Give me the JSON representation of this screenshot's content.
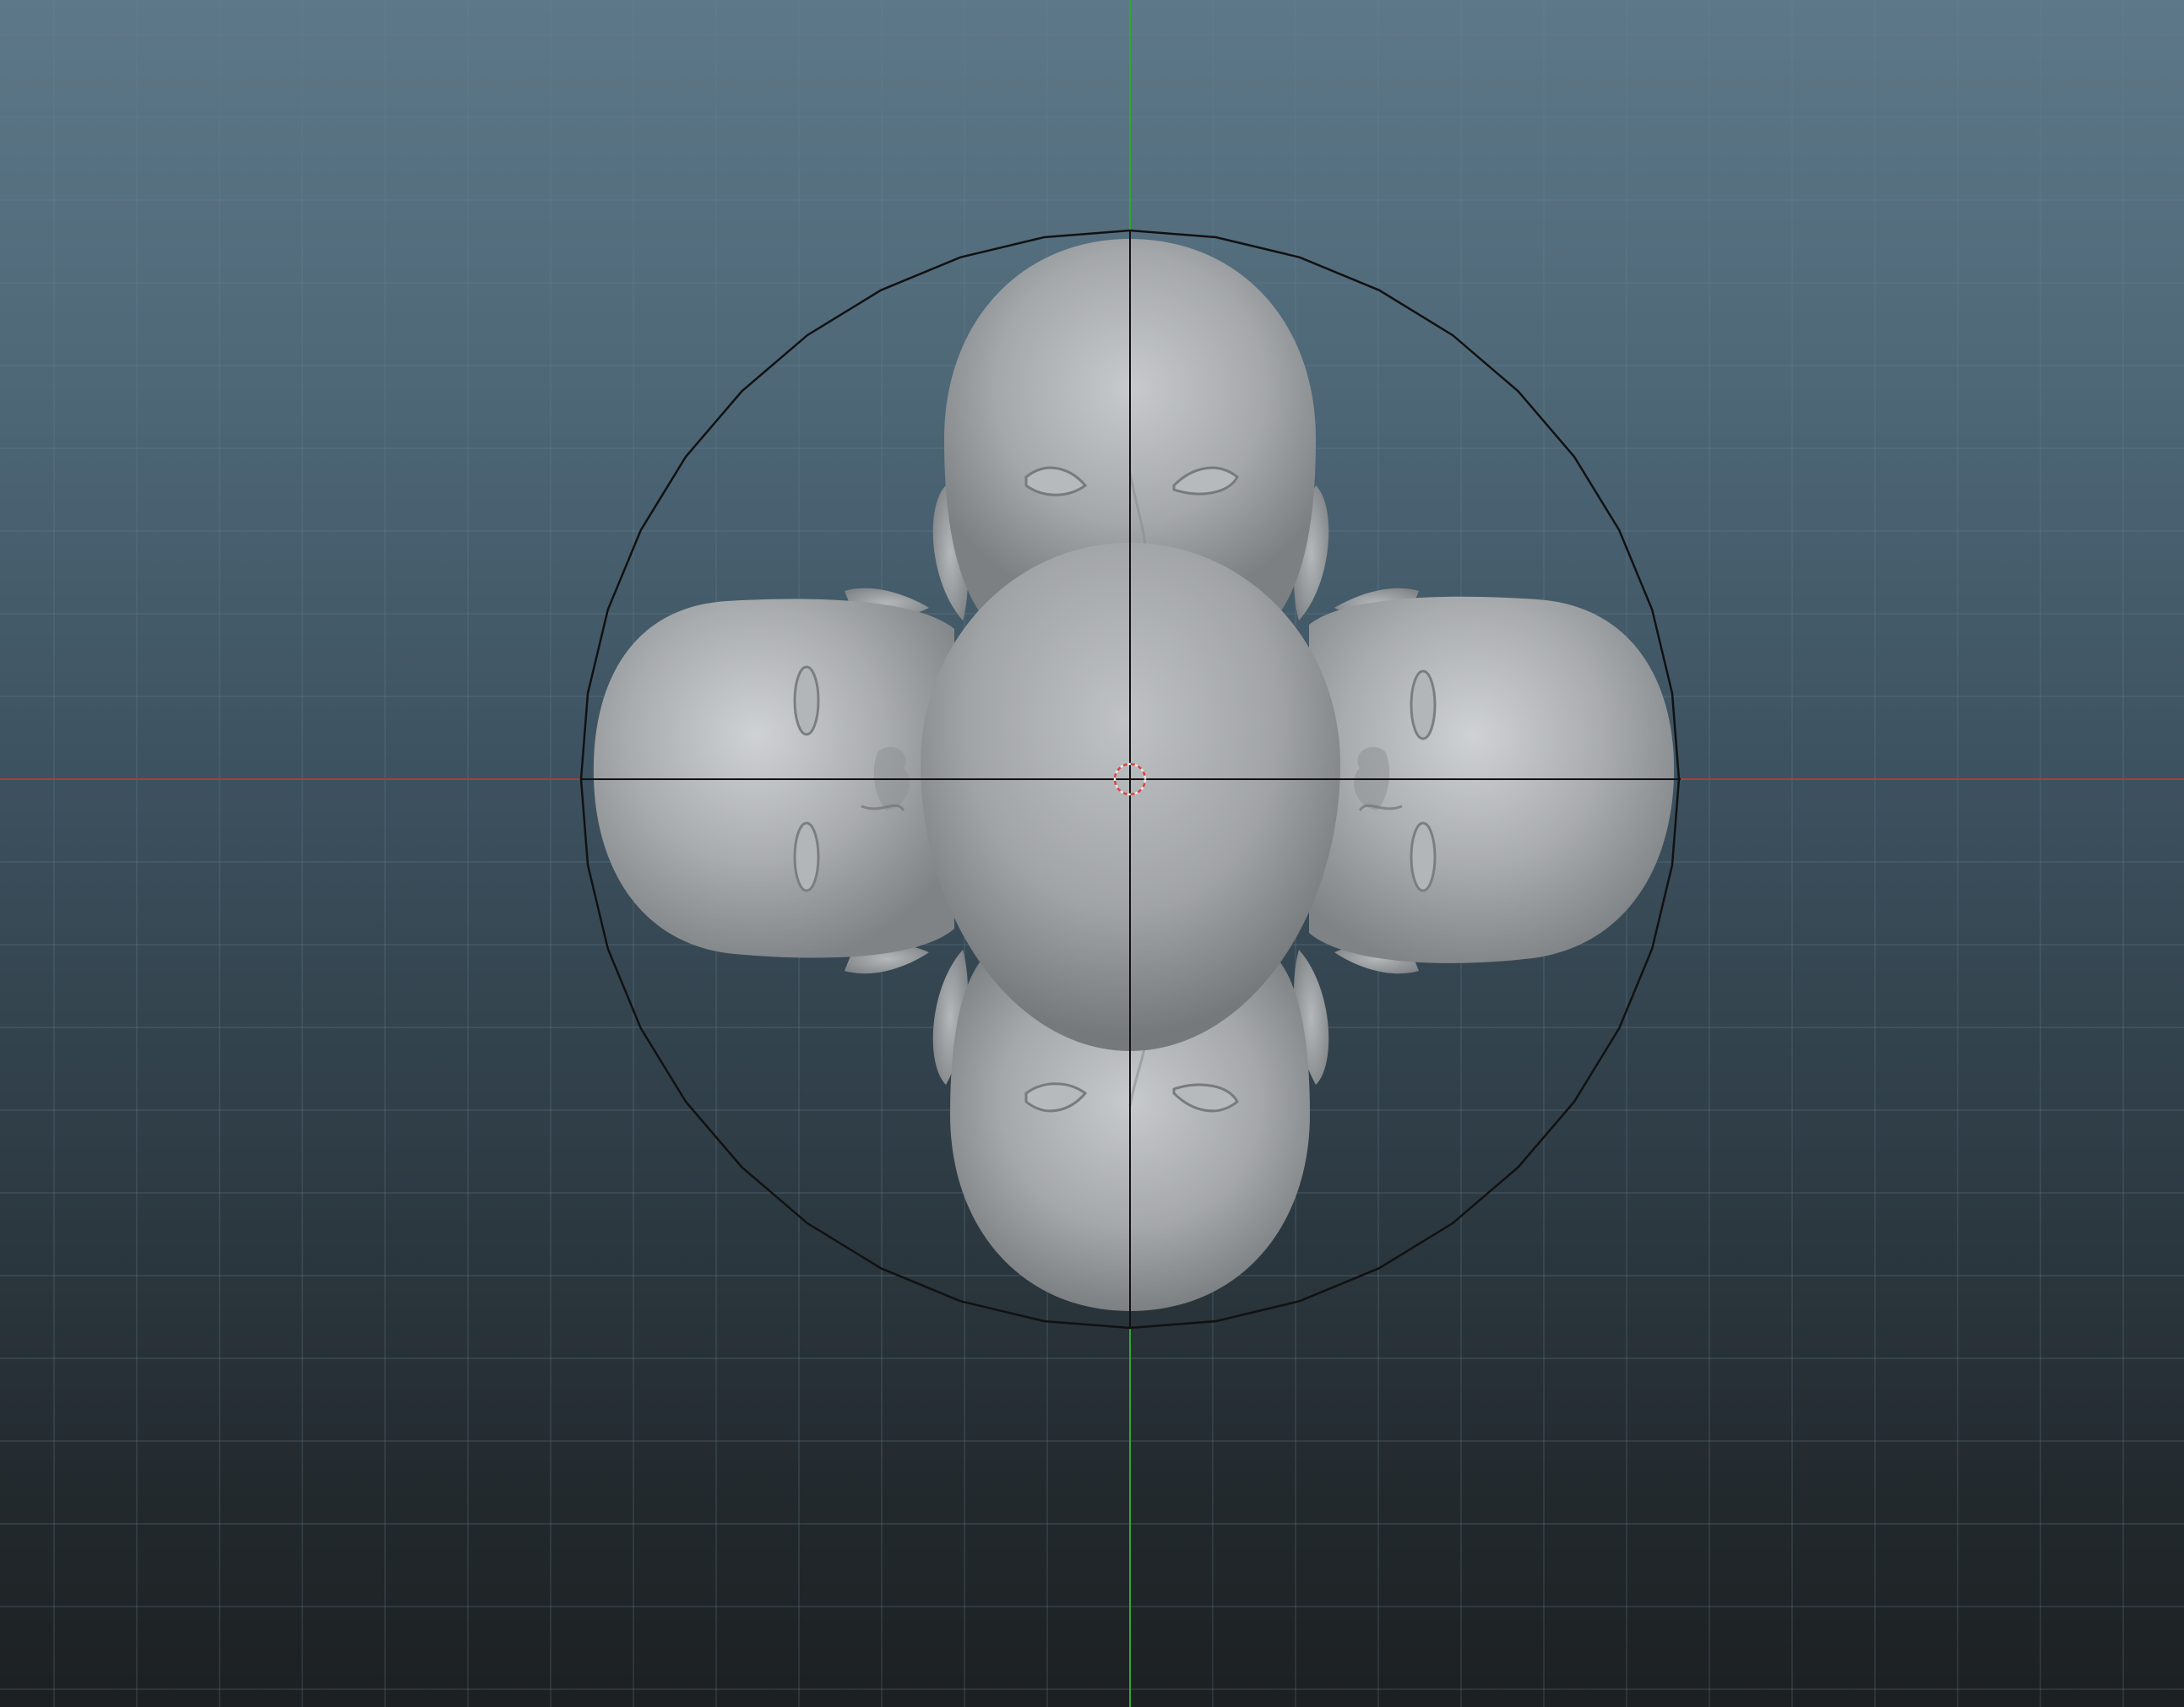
{
  "viewport": {
    "background_top": "#5d7888",
    "background_bottom": "#1c2022",
    "grid_color": "#6c8595",
    "x_axis_color": "#b23a3a",
    "y_axis_color": "#2fa82f",
    "manipulator_color": "#111111",
    "model_color": "#a9acae"
  },
  "scene": {
    "objects": [
      {
        "name": "head-top",
        "orientation": "upright"
      },
      {
        "name": "head-left",
        "orientation": "rotated-90-ccw"
      },
      {
        "name": "head-right",
        "orientation": "rotated-90-cw"
      },
      {
        "name": "head-bottom",
        "orientation": "upside-down"
      },
      {
        "name": "head-center",
        "orientation": "viewed-from-top"
      }
    ]
  }
}
